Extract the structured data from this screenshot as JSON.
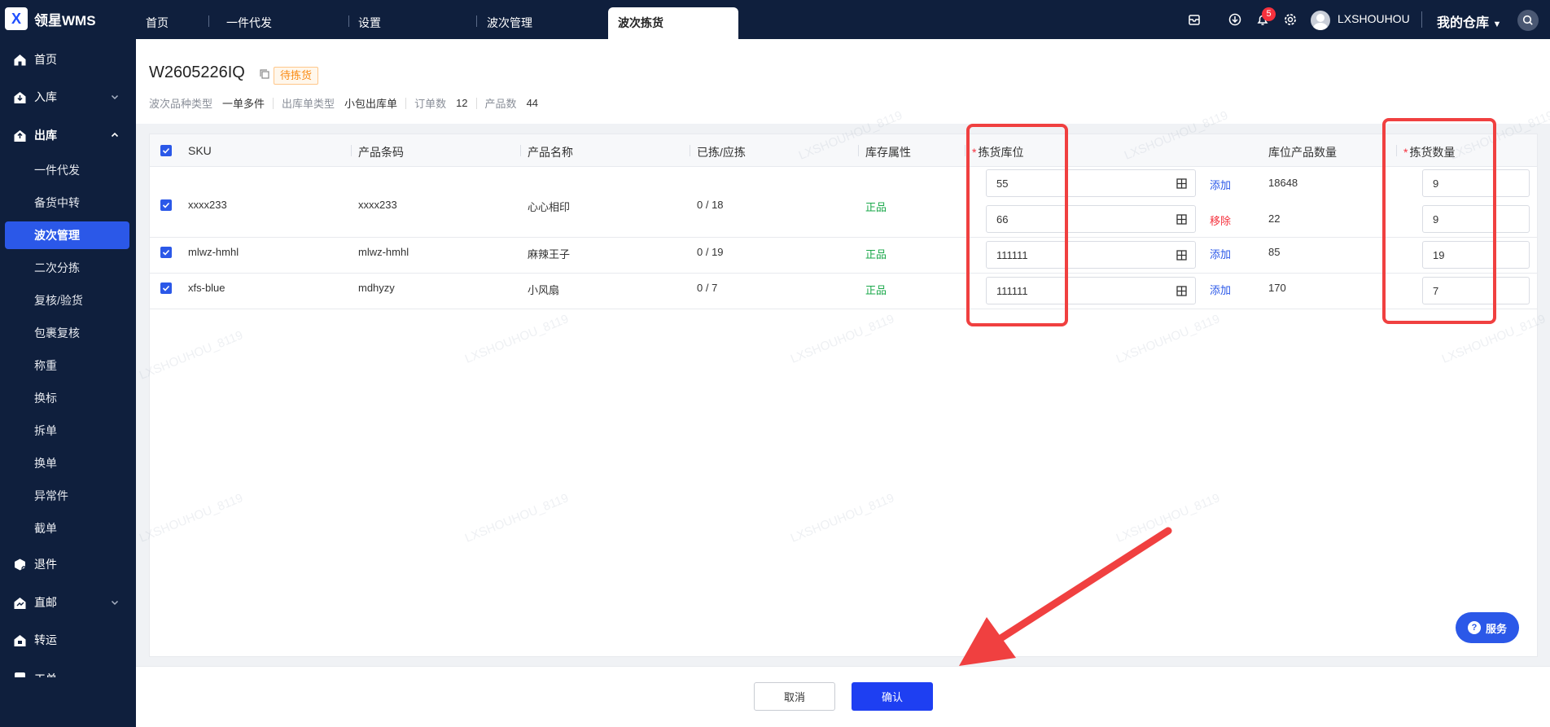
{
  "app": {
    "logo_letter": "X",
    "name": "领星WMS"
  },
  "tabs": [
    {
      "label": "首页"
    },
    {
      "label": "一件代发"
    },
    {
      "label": "设置"
    },
    {
      "label": "波次管理"
    },
    {
      "label": "波次拣货",
      "active": true
    }
  ],
  "topbar": {
    "notification_count": "5",
    "username": "LXSHOUHOU",
    "warehouse": "我的仓库"
  },
  "sidebar": {
    "items": [
      {
        "label": "首页",
        "icon": "home-icon"
      },
      {
        "label": "入库",
        "icon": "inbound-icon"
      },
      {
        "label": "出库",
        "icon": "outbound-icon",
        "expanded": true
      },
      {
        "label": "退件",
        "icon": "return-icon"
      },
      {
        "label": "直邮",
        "icon": "direct-mail-icon"
      },
      {
        "label": "转运",
        "icon": "transfer-icon"
      },
      {
        "label": "工单",
        "icon": "ticket-icon"
      }
    ],
    "sub_items": [
      "一件代发",
      "备货中转",
      "波次管理",
      "二次分拣",
      "复核/验货",
      "包裹复核",
      "称重",
      "换标",
      "拆单",
      "换单",
      "异常件",
      "截单"
    ],
    "active_sub": "波次管理"
  },
  "wave": {
    "number": "W2605226IQ",
    "status": "待拣货",
    "meta": [
      {
        "key": "波次品种类型",
        "value": "一单多件"
      },
      {
        "key": "出库单类型",
        "value": "小包出库单"
      },
      {
        "key": "订单数",
        "value": "12"
      },
      {
        "key": "产品数",
        "value": "44"
      }
    ]
  },
  "table": {
    "headers": {
      "sku": "SKU",
      "barcode": "产品条码",
      "name": "产品名称",
      "picked": "已拣/应拣",
      "attr": "库存属性",
      "location": "拣货库位",
      "location_qty": "库位产品数量",
      "pick_qty": "拣货数量"
    },
    "rows": [
      {
        "sku": "xxxx233",
        "barcode": "xxxx233",
        "name": "心心相印",
        "picked": "0 / 18",
        "attr": "正品",
        "locations": [
          {
            "location": "55",
            "action": "添加",
            "stock": "18648",
            "qty": "9"
          },
          {
            "location": "66",
            "action": "移除",
            "stock": "22",
            "qty": "9"
          }
        ]
      },
      {
        "sku": "mlwz-hmhl",
        "barcode": "mlwz-hmhl",
        "name": "麻辣王子",
        "picked": "0 / 19",
        "attr": "正品",
        "locations": [
          {
            "location": "111111",
            "action": "添加",
            "stock": "85",
            "qty": "19"
          }
        ]
      },
      {
        "sku": "xfs-blue",
        "barcode": "mdhyzy",
        "name": "小风扇",
        "picked": "0 / 7",
        "attr": "正品",
        "locations": [
          {
            "location": "111111",
            "action": "添加",
            "stock": "170",
            "qty": "7"
          }
        ]
      }
    ]
  },
  "footer": {
    "cancel": "取消",
    "confirm": "确认"
  },
  "service": {
    "label": "服务"
  },
  "watermark": "LXSHOUHOU_8119",
  "colors": {
    "primary": "#2b58e8",
    "nav_bg": "#0f1f3d",
    "danger": "#f5313d",
    "success": "#1aa84a",
    "annotation": "#f04040"
  }
}
